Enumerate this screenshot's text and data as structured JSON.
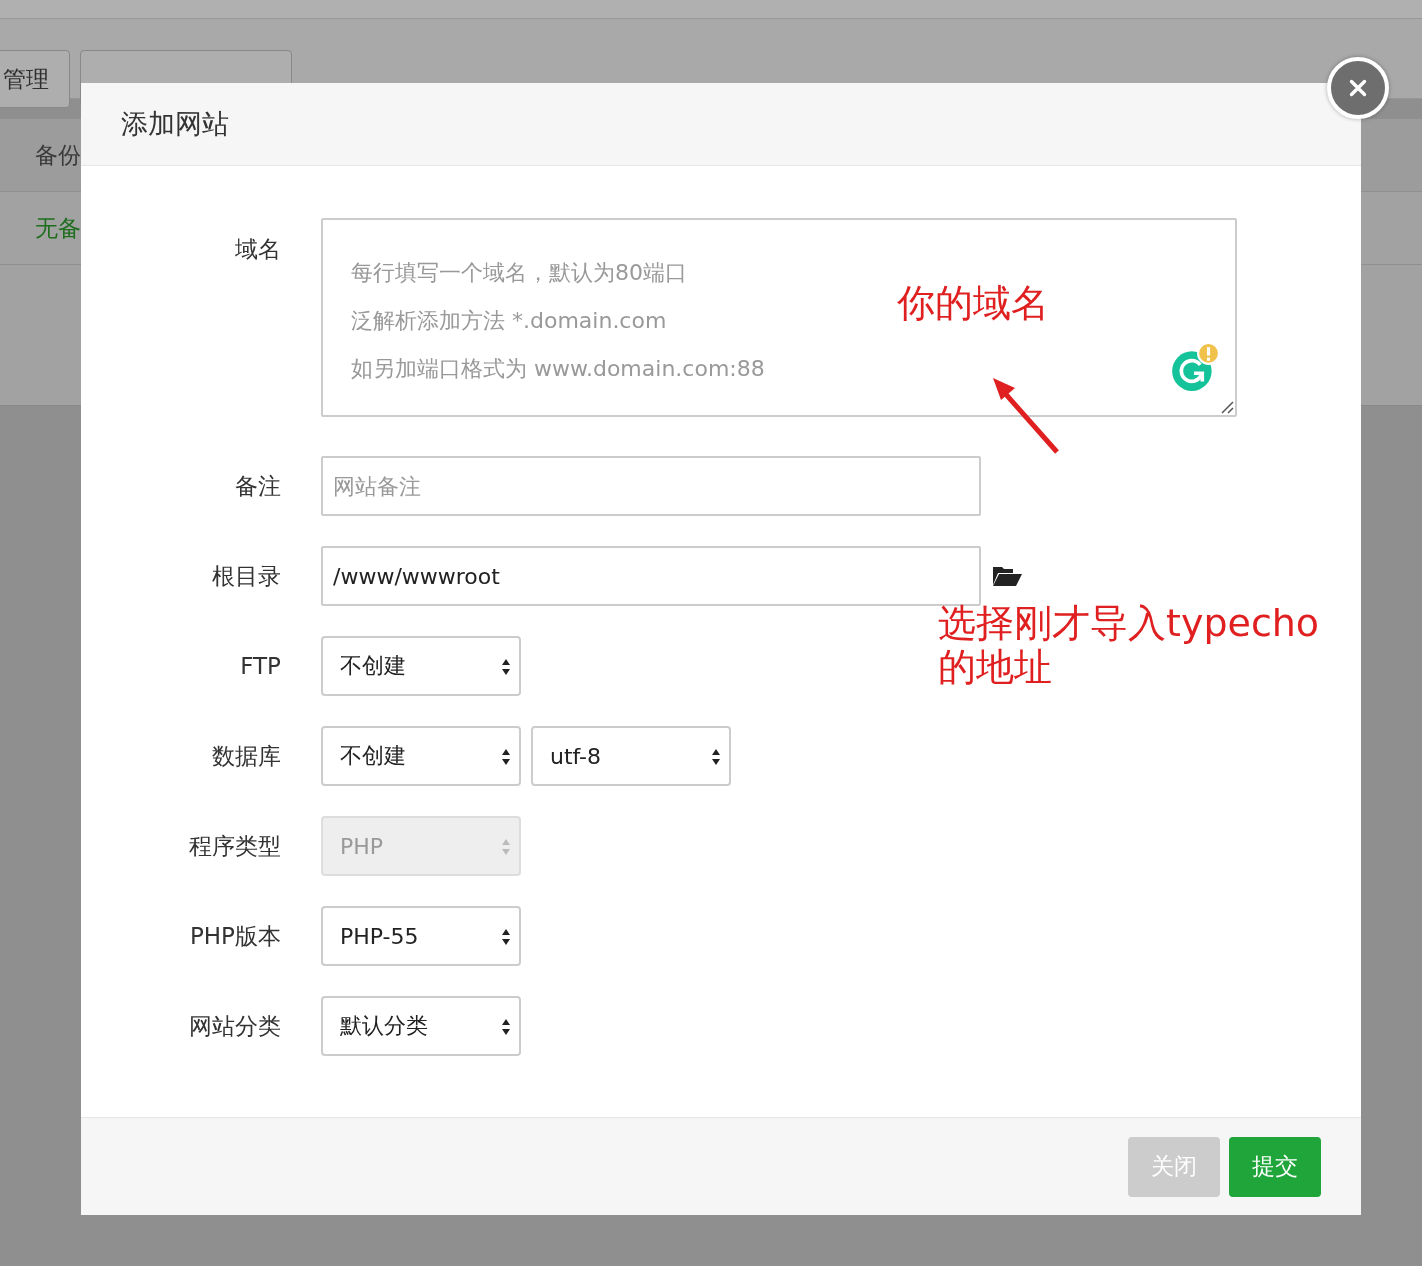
{
  "background": {
    "tabs": [
      "管理"
    ],
    "table_header": "备份",
    "table_cell": "无备"
  },
  "dialog": {
    "title": "添加网站",
    "fields": [
      {
        "kind": "textarea",
        "label": "域名",
        "placeholder": [
          "每行填写一个域名，默认为80端口",
          "泛解析添加方法 *.domain.com",
          "如另加端口格式为 www.domain.com:88"
        ]
      },
      {
        "kind": "input",
        "label": "备注",
        "placeholder": "网站备注"
      },
      {
        "kind": "path",
        "label": "根目录",
        "value": "/www/wwwroot"
      },
      {
        "kind": "select",
        "label": "FTP",
        "selects": [
          {
            "value": "不创建",
            "disabled": false
          }
        ]
      },
      {
        "kind": "select",
        "label": "数据库",
        "selects": [
          {
            "value": "不创建",
            "disabled": false
          },
          {
            "value": "utf-8",
            "disabled": false
          }
        ]
      },
      {
        "kind": "select",
        "label": "程序类型",
        "selects": [
          {
            "value": "PHP",
            "disabled": true
          }
        ]
      },
      {
        "kind": "select",
        "label": "PHP版本",
        "selects": [
          {
            "value": "PHP-55",
            "disabled": false
          }
        ]
      },
      {
        "kind": "select",
        "label": "网站分类",
        "selects": [
          {
            "value": "默认分类",
            "disabled": false
          }
        ]
      }
    ],
    "buttons": [
      {
        "label": "关闭",
        "kind": "secondary"
      },
      {
        "label": "提交",
        "kind": "primary"
      }
    ]
  },
  "annotations": [
    {
      "text": "你的域名",
      "kind": "arrow-note"
    },
    {
      "text": "选择刚才导入typecho的地址",
      "kind": "note"
    }
  ]
}
